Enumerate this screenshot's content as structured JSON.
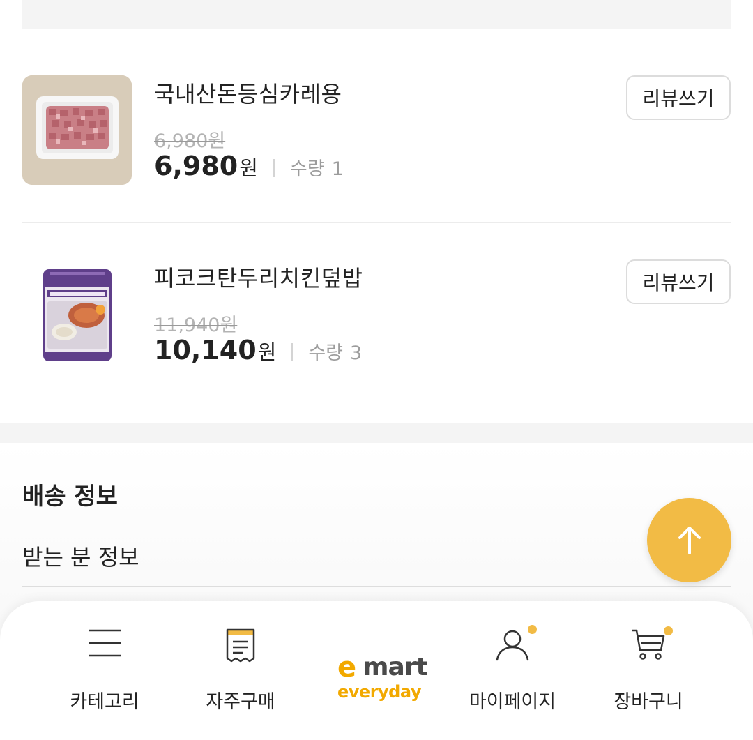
{
  "products": [
    {
      "name": "국내산돈등심카레용",
      "original_price": "6,980원",
      "price": "6,980",
      "currency": "원",
      "qty_label": "수량",
      "qty": "1",
      "review_label": "리뷰쓰기"
    },
    {
      "name": "피코크탄두리치킨덮밥",
      "original_price": "11,940원",
      "price": "10,140",
      "currency": "원",
      "qty_label": "수량",
      "qty": "3",
      "review_label": "리뷰쓰기"
    }
  ],
  "delivery": {
    "title": "배송 정보",
    "receiver_label": "받는 분 정보"
  },
  "bottom_nav": {
    "items": [
      {
        "label": "카테고리",
        "icon": "menu-icon"
      },
      {
        "label": "자주구매",
        "icon": "receipt-icon"
      },
      {
        "label": "마이페이지",
        "icon": "user-icon"
      },
      {
        "label": "장바구니",
        "icon": "cart-icon"
      }
    ],
    "logo": {
      "top": "mart",
      "accent": "e",
      "bottom": "everyday"
    }
  },
  "colors": {
    "accent": "#f2bb45",
    "logo_yellow": "#f2a900",
    "logo_gray": "#4a4a4a"
  }
}
